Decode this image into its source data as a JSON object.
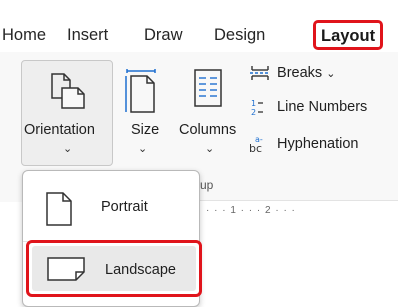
{
  "tabs": [
    {
      "label": "Home"
    },
    {
      "label": "Insert"
    },
    {
      "label": "Draw"
    },
    {
      "label": "Design"
    },
    {
      "label": "Layout",
      "active": true
    }
  ],
  "ribbon": {
    "orientation_label": "Orientation",
    "size_label": "Size",
    "columns_label": "Columns",
    "breaks_label": "Breaks",
    "line_numbers_label": "Line Numbers",
    "hyphenation_label": "Hyphenation",
    "group_label_fragment": "up",
    "ruler_text": "· · · 1 · · · 2 · · ·"
  },
  "orientation_menu": {
    "items": [
      {
        "label": "Portrait",
        "icon": "portrait-page-icon"
      },
      {
        "label": "Landscape",
        "icon": "landscape-page-icon",
        "highlighted": true
      }
    ]
  },
  "colors": {
    "highlight": "#e0141b",
    "ribbon_bg": "#f8f8f8",
    "icon_blue": "#1e6fd0"
  }
}
